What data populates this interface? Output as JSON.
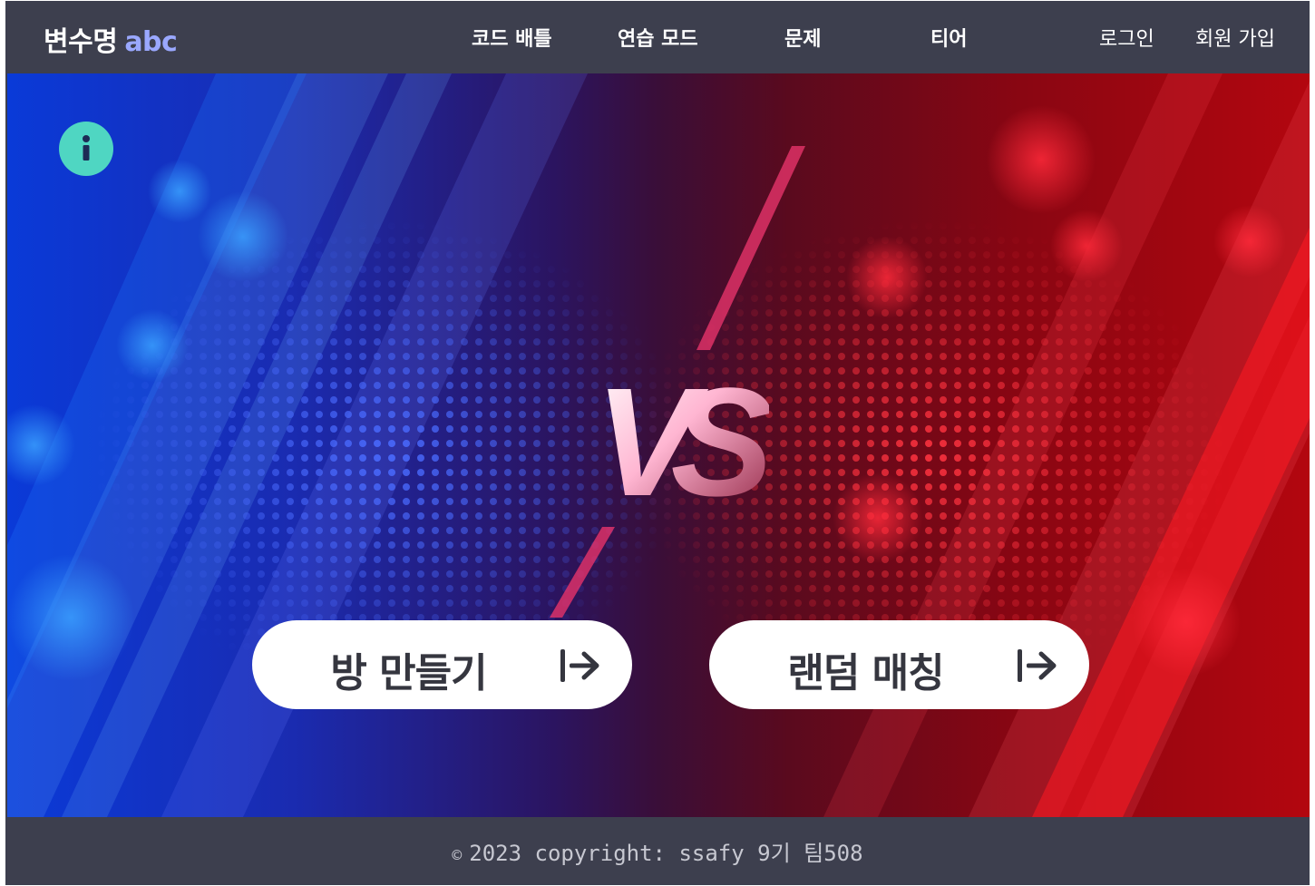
{
  "brand": {
    "name": "변수명",
    "accent": "abc"
  },
  "nav": {
    "links": [
      "코드 배틀",
      "연습 모드",
      "문제",
      "티어"
    ],
    "login": "로그인",
    "signup": "회원 가입"
  },
  "hero": {
    "vs_text": "VS",
    "info_icon": "info-icon",
    "buttons": [
      {
        "label": "방 만들기",
        "icon": "arrow-right-to-bar-icon"
      },
      {
        "label": "랜덤 매칭",
        "icon": "arrow-right-to-bar-icon"
      }
    ]
  },
  "footer": {
    "symbol": "©",
    "text": "2023 copyright: ssafy 9기 팀508"
  },
  "colors": {
    "nav_bg": "#3d3f4e",
    "accent": "#9aa8ff",
    "info_button": "#4fd6c2",
    "blue_side": "#0a3ad8",
    "red_side": "#b3060f"
  }
}
